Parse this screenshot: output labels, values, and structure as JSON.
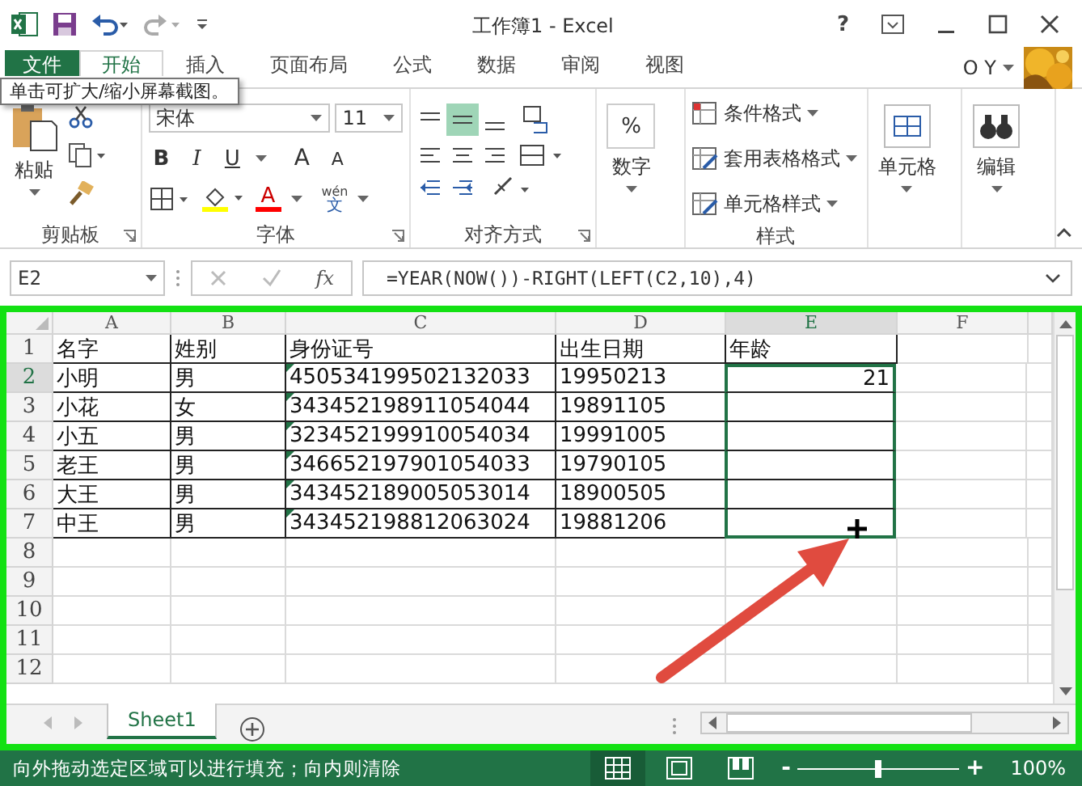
{
  "title_bar": {
    "title": "工作簿1 - Excel",
    "help": "?"
  },
  "ribbon_tabs": [
    {
      "label": "文件",
      "kind": "file",
      "selected": false
    },
    {
      "label": "开始",
      "kind": "tab",
      "selected": true
    },
    {
      "label": "插入",
      "kind": "tab",
      "selected": false
    },
    {
      "label": "页面布局",
      "kind": "tab",
      "selected": false
    },
    {
      "label": "公式",
      "kind": "tab",
      "selected": false
    },
    {
      "label": "数据",
      "kind": "tab",
      "selected": false
    },
    {
      "label": "审阅",
      "kind": "tab",
      "selected": false
    },
    {
      "label": "视图",
      "kind": "tab",
      "selected": false
    }
  ],
  "user": "O Y",
  "tooltip": "单击可扩大/缩小屏幕截图。",
  "ribbon": {
    "clipboard": {
      "paste": "粘贴",
      "label": "剪贴板"
    },
    "font": {
      "font_name": "宋体",
      "font_size": "11",
      "bold": "B",
      "italic": "I",
      "underline": "U",
      "grow": "A",
      "shrink": "A",
      "font_color": "A",
      "phonetic_top": "wén",
      "phonetic_bottom": "文",
      "label": "字体"
    },
    "alignment": {
      "label": "对齐方式"
    },
    "number": {
      "button": "数字",
      "symbol": "%"
    },
    "styles": {
      "items": [
        "条件格式",
        "套用表格格式",
        "单元格样式"
      ],
      "label": "样式"
    },
    "cells": {
      "button": "单元格"
    },
    "editing": {
      "button": "编辑"
    }
  },
  "formula_bar": {
    "name_box": "E2",
    "function_symbol": "fx",
    "formula": "=YEAR(NOW())-RIGHT(LEFT(C2,10),4)"
  },
  "sheet": {
    "columns": [
      {
        "label": "A",
        "selected": false
      },
      {
        "label": "B",
        "selected": false
      },
      {
        "label": "C",
        "selected": false
      },
      {
        "label": "D",
        "selected": false
      },
      {
        "label": "E",
        "selected": true
      },
      {
        "label": "F",
        "selected": false
      }
    ],
    "rows": [
      {
        "number": "1",
        "selected": false,
        "in_selection": false,
        "id_warning": false,
        "cells": [
          "名字",
          "姓别",
          "身份证号",
          "出生日期",
          "年龄"
        ]
      },
      {
        "number": "2",
        "selected": true,
        "in_selection": true,
        "id_warning": true,
        "cells": [
          "小明",
          "男",
          "450534199502132033",
          "19950213",
          "21"
        ]
      },
      {
        "number": "3",
        "selected": false,
        "in_selection": true,
        "id_warning": true,
        "cells": [
          "小花",
          "女",
          "343452198911054044",
          "19891105"
        ]
      },
      {
        "number": "4",
        "selected": false,
        "in_selection": true,
        "id_warning": true,
        "cells": [
          "小五",
          "男",
          "323452199910054034",
          "19991005"
        ]
      },
      {
        "number": "5",
        "selected": false,
        "in_selection": true,
        "id_warning": true,
        "cells": [
          "老王",
          "男",
          "346652197901054033",
          "19790105"
        ]
      },
      {
        "number": "6",
        "selected": false,
        "in_selection": true,
        "id_warning": true,
        "cells": [
          "大王",
          "男",
          "343452189005053014",
          "18900505"
        ]
      },
      {
        "number": "7",
        "selected": false,
        "in_selection": true,
        "id_warning": true,
        "cells": [
          "中王",
          "男",
          "343452198812063024",
          "19881206"
        ]
      },
      {
        "number": "8",
        "selected": false,
        "in_selection": false,
        "id_warning": false
      },
      {
        "number": "9",
        "selected": false,
        "in_selection": false,
        "id_warning": false
      },
      {
        "number": "10",
        "selected": false,
        "in_selection": false,
        "id_warning": false
      },
      {
        "number": "11",
        "selected": false,
        "in_selection": false,
        "id_warning": false
      },
      {
        "number": "12",
        "selected": false,
        "in_selection": false,
        "id_warning": false
      }
    ]
  },
  "sheet_tabs": [
    {
      "label": "Sheet1",
      "selected": true
    }
  ],
  "status_bar": {
    "message": "向外拖动选定区域可以进行填充；向内则清除",
    "views": [
      {
        "kind": "normal",
        "selected": true
      },
      {
        "kind": "page_layout",
        "selected": false
      },
      {
        "kind": "page_break",
        "selected": false
      }
    ],
    "zoom_out": "-",
    "zoom_in": "+",
    "zoom": {
      "level": 0.5
    },
    "zoom_label": "100%"
  }
}
